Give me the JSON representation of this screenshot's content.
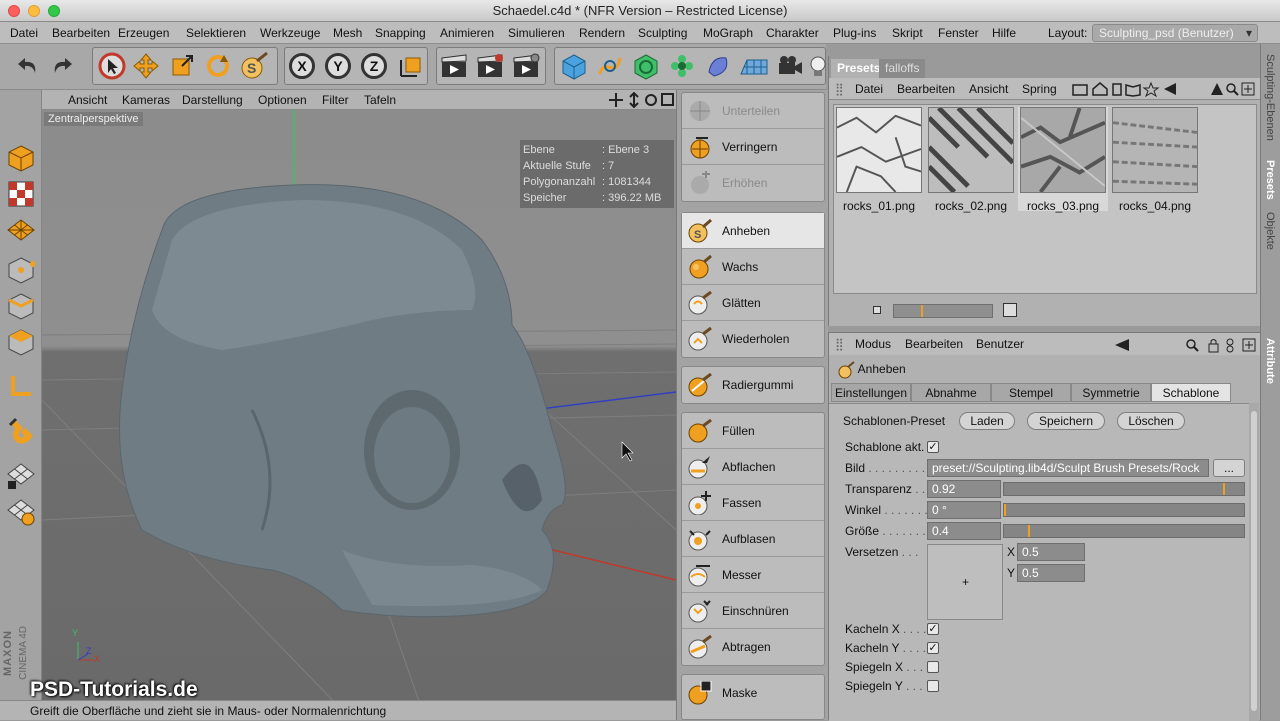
{
  "window": {
    "title": "Schaedel.c4d * (NFR Version – Restricted License)"
  },
  "menu": {
    "items": [
      "Datei",
      "Bearbeiten",
      "Erzeugen",
      "Selektieren",
      "Werkzeuge",
      "Mesh",
      "Snapping",
      "Animieren",
      "Simulieren",
      "Rendern",
      "Sculpting",
      "MoGraph",
      "Charakter",
      "Plug-ins",
      "Skript",
      "Fenster",
      "Hilfe"
    ],
    "layout_label": "Layout:",
    "layout_value": "Sculpting_psd (Benutzer)"
  },
  "toolbar": {
    "undo_icon": "undo-icon",
    "redo_icon": "redo-icon",
    "x": "X",
    "y": "Y",
    "z": "Z"
  },
  "viewport": {
    "menu": [
      "Ansicht",
      "Kameras",
      "Darstellung",
      "Optionen",
      "Filter",
      "Tafeln"
    ],
    "camera_label": "Zentralperspektive",
    "hud": [
      {
        "k": "Ebene",
        "v": ": Ebene 3"
      },
      {
        "k": "Aktuelle Stufe",
        "v": ": 7"
      },
      {
        "k": "Polygonanzahl",
        "v": ": 1081344"
      },
      {
        "k": "Speicher",
        "v": ": 396.22 MB"
      }
    ],
    "axis_x": "X",
    "axis_y": "Y",
    "axis_z": "Z",
    "vendor_line1": "MAXON",
    "vendor_line2": "CINEMA 4D"
  },
  "status": {
    "text": "Greift die Oberfläche und zieht sie in Maus- oder Normalenrichtung"
  },
  "watermark": "PSD-Tutorials.de",
  "brushes": {
    "group1": [
      "Unterteilen",
      "Verringern",
      "Erhöhen"
    ],
    "group2": [
      "Anheben",
      "Wachs",
      "Glätten",
      "Wiederholen"
    ],
    "group3": [
      "Radiergummi"
    ],
    "group4": [
      "Füllen",
      "Abflachen",
      "Fassen",
      "Aufblasen",
      "Messer",
      "Einschnüren",
      "Abtragen"
    ],
    "group5": [
      "Maske"
    ]
  },
  "presets": {
    "tabs": [
      "Presets",
      "falloffs"
    ],
    "menu": [
      "Datei",
      "Bearbeiten",
      "Ansicht",
      "Spring"
    ],
    "items": [
      "rocks_01.png",
      "rocks_02.png",
      "rocks_03.png",
      "rocks_04.png"
    ],
    "zoom_fraction": 0.28
  },
  "attributes": {
    "menu": [
      "Modus",
      "Bearbeiten",
      "Benutzer"
    ],
    "object": "Anheben",
    "tabs": [
      "Einstellungen",
      "Abnahme",
      "Stempel",
      "Symmetrie",
      "Schablone"
    ],
    "section": "Schablonen-Preset",
    "buttons": [
      "Laden",
      "Speichern",
      "Löschen"
    ],
    "schablone_akt": "Schablone akt.",
    "bild_label": "Bild",
    "bild_value": "preset://Sculpting.lib4d/Sculpt Brush Presets/Rock",
    "browse": "...",
    "transparenz_label": "Transparenz",
    "transparenz_value": "0.92",
    "transparenz": 0.92,
    "winkel_label": "Winkel",
    "winkel_value": "0 °",
    "winkel": 0,
    "groesse_label": "Größe",
    "groesse_value": "0.4",
    "groesse": 0.4,
    "versetzen_label": "Versetzen",
    "x_label": "X",
    "x_value": "0.5",
    "y_label": "Y",
    "y_value": "0.5",
    "kacheln_x": "Kacheln X",
    "kacheln_y": "Kacheln Y",
    "spiegeln_x": "Spiegeln X",
    "spiegeln_y": "Spiegeln Y",
    "check": "✓"
  },
  "side_tabs": [
    "Sculpting-Ebenen",
    "Presets",
    "Objekte",
    "Attribute"
  ]
}
